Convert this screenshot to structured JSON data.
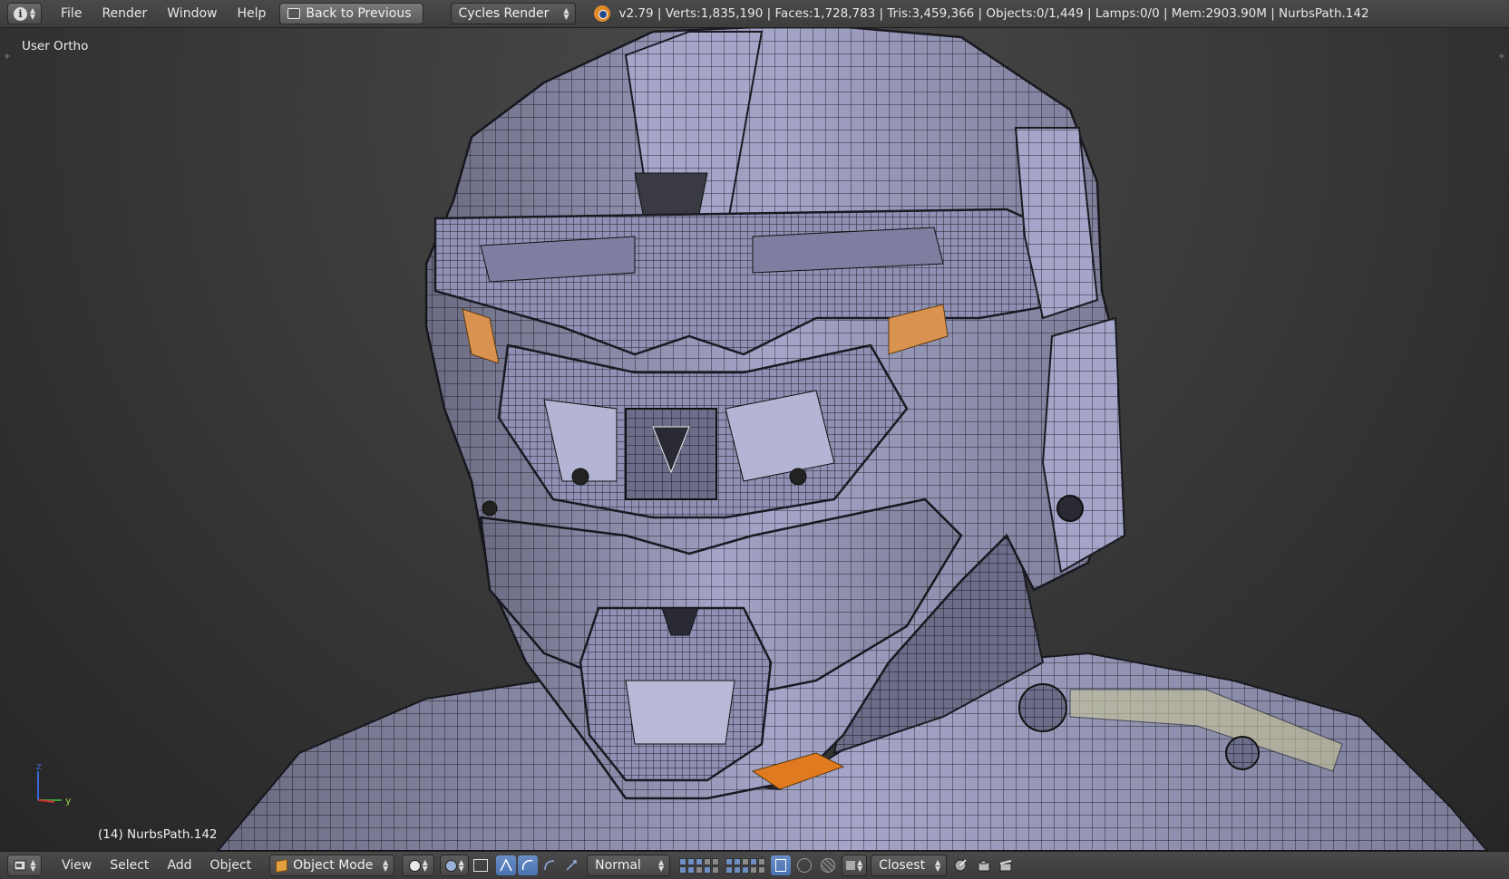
{
  "header": {
    "editor_icon": "info-icon",
    "menu": [
      "File",
      "Render",
      "Window",
      "Help"
    ],
    "back_button": "Back to Previous",
    "render_engine": "Cycles Render",
    "stats": "v2.79 | Verts:1,835,190 | Faces:1,728,783 | Tris:3,459,366 | Objects:0/1,449 | Lamps:0/0 | Mem:2903.90M | NurbsPath.142"
  },
  "viewport": {
    "view_label": "User Ortho",
    "object_label": "(14) NurbsPath.142",
    "axis_z": "z",
    "axis_y": "y"
  },
  "footer": {
    "menu": [
      "View",
      "Select",
      "Add",
      "Object"
    ],
    "mode": "Object Mode",
    "pivot_label": "Normal",
    "snap_label": "Closest"
  },
  "colors": {
    "mesh": "#9fa0c4",
    "wire": "#1a1a22",
    "accent_orange": "#d99250",
    "active_blue": "#5b82bf"
  }
}
